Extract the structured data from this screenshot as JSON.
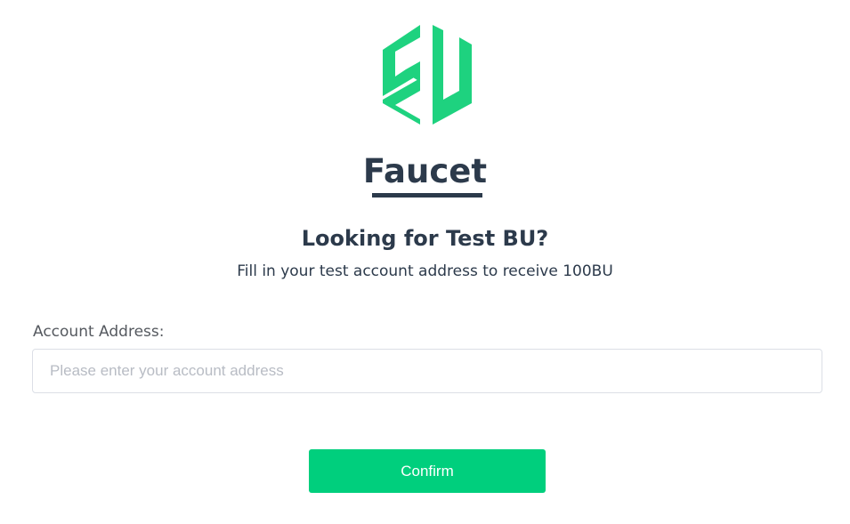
{
  "brand": {
    "logo_icon": "bu-hexagon-logo-icon",
    "accent_color": "#00cf7d",
    "logo_color": "#1ed27f"
  },
  "header": {
    "title": "Faucet",
    "subtitle": "Looking for Test BU?",
    "description": "Fill in your test account address to receive 100BU"
  },
  "form": {
    "address_label": "Account Address:",
    "address_value": "",
    "address_placeholder": "Please enter your account address",
    "confirm_label": "Confirm"
  }
}
